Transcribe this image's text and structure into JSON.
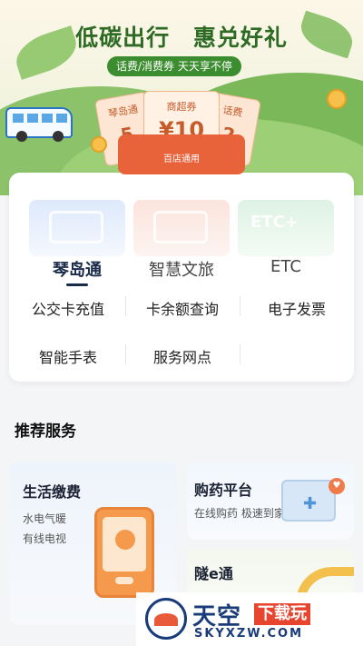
{
  "banner": {
    "title_part1": "低碳出行",
    "title_part2": "惠兑好礼",
    "pill": "话费/消费券 天天享不停",
    "coupon_left": {
      "label": "琴岛通",
      "value": "5"
    },
    "coupon_main": {
      "label": "商超券",
      "value": "¥10",
      "sub": "百店通用"
    },
    "coupon_right": {
      "label": "话费",
      "value": "2"
    }
  },
  "service_card": {
    "tabs": [
      {
        "label": "琴岛通",
        "active": true
      },
      {
        "label": "智慧文旅",
        "active": false
      },
      {
        "label": "ETC",
        "active": false
      }
    ],
    "tab3_ghost": "ETC+",
    "items": [
      "公交卡充值",
      "卡余额查询",
      "电子发票",
      "智能手表",
      "服务网点"
    ]
  },
  "recommended": {
    "title": "推荐服务",
    "life_pay": {
      "title": "生活缴费",
      "sub1": "水电气暖",
      "sub2": "有线电视"
    },
    "pharmacy": {
      "title": "购药平台",
      "sub": "在线购药 极速到家"
    },
    "tunnel": {
      "title": "隧e通"
    }
  },
  "watermark": {
    "cn1": "天空",
    "cn2": "下载玩",
    "en": "SKYXZW.COM"
  },
  "colors": {
    "accent_green": "#3c8d2f",
    "coupon_orange": "#e8623a",
    "text_dark": "#1a2a4a"
  }
}
